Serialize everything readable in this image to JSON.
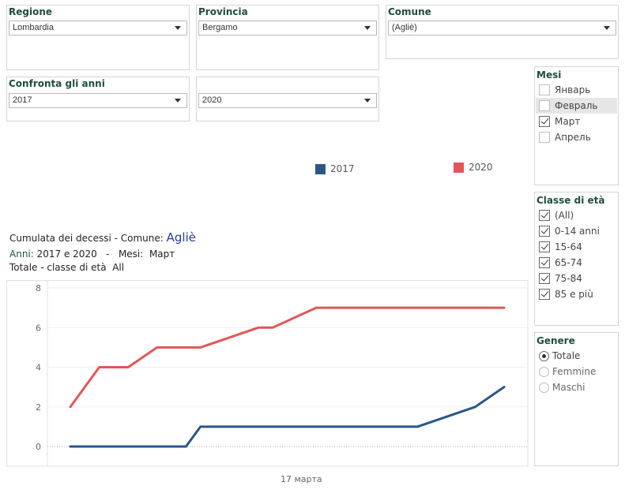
{
  "filters": {
    "regione": {
      "title": "Regione",
      "value": "Lombardia"
    },
    "provincia": {
      "title": "Provincia",
      "value": "Bergamo"
    },
    "comune": {
      "title": "Comune",
      "value": "(Agliè)"
    },
    "confronta": {
      "title": "Confronta gli anni",
      "value": "2017"
    },
    "anno2": {
      "value": "2020"
    }
  },
  "mesi": {
    "title": "Mesi",
    "items": [
      {
        "label": "Январь",
        "checked": false
      },
      {
        "label": "Февраль",
        "checked": false
      },
      {
        "label": "Март",
        "checked": true
      },
      {
        "label": "Апрель",
        "checked": false
      }
    ]
  },
  "classe_eta": {
    "title": "Classe di età",
    "items": [
      {
        "label": "(All)",
        "checked": true
      },
      {
        "label": "0-14 anni",
        "checked": true
      },
      {
        "label": "15-64",
        "checked": true
      },
      {
        "label": "65-74",
        "checked": true
      },
      {
        "label": "75-84",
        "checked": true
      },
      {
        "label": "85 e più",
        "checked": true
      }
    ]
  },
  "genere": {
    "title": "Genere",
    "items": [
      {
        "label": "Totale",
        "selected": true
      },
      {
        "label": "Femmine",
        "selected": false
      },
      {
        "label": "Maschi",
        "selected": false
      }
    ]
  },
  "legend": [
    {
      "label": "2017",
      "color": "#2b5784"
    },
    {
      "label": "2020",
      "color": "#e15759"
    }
  ],
  "header": {
    "line1_prefix": "Cumulata dei decessi -  Comune: ",
    "comune": "Agliè",
    "line2_label": "Anni: ",
    "line2_value": "2017 e 2020",
    "line2_sep": "   -   ",
    "line2_mesi_label": "Mesi:  ",
    "line2_mesi_value": "Март",
    "line3_label": "Totale - classe di età  ",
    "line3_value": "All"
  },
  "chart_data": {
    "type": "line",
    "x_category_label": "17 марта",
    "x": [
      1,
      2,
      3,
      4,
      5,
      6,
      7,
      8,
      9,
      10,
      11,
      12,
      13,
      14,
      15,
      16,
      17,
      18,
      19,
      20,
      21,
      22,
      23,
      24,
      25,
      26,
      27,
      28,
      29,
      30,
      31
    ],
    "ylim": [
      -0.8,
      8
    ],
    "yticks": [
      0,
      2,
      4,
      6,
      8
    ],
    "grid": true,
    "legend_position": "top",
    "series": [
      {
        "name": "2017",
        "color": "#2b5784",
        "points": [
          [
            1,
            0
          ],
          [
            9,
            0
          ],
          [
            10,
            1
          ],
          [
            25,
            1
          ],
          [
            29,
            2
          ],
          [
            31,
            3
          ]
        ]
      },
      {
        "name": "2020",
        "color": "#e15759",
        "points": [
          [
            1,
            2
          ],
          [
            3,
            4
          ],
          [
            5,
            4
          ],
          [
            7,
            5
          ],
          [
            10,
            5
          ],
          [
            14,
            6
          ],
          [
            15,
            6
          ],
          [
            18,
            7
          ],
          [
            31,
            7
          ]
        ]
      }
    ]
  }
}
